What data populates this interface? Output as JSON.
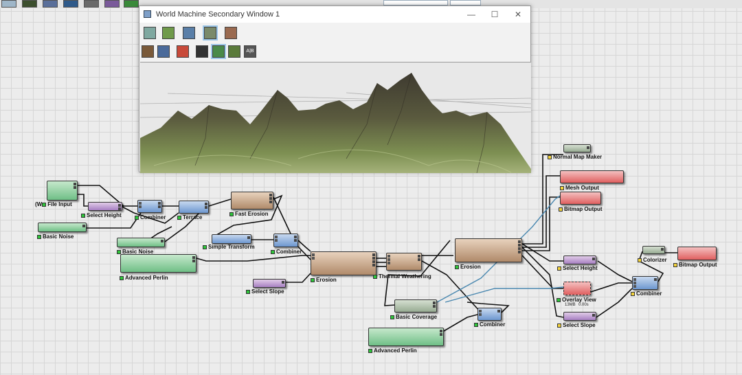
{
  "secondary_window": {
    "title": "World Machine Secondary Window 1",
    "controls": {
      "minimize": "—",
      "maximize": "☐",
      "close": "✕"
    },
    "ab_button": "A|B"
  },
  "nodes": {
    "file_input": "File Input",
    "file_input_prefix": "(W",
    "select_height_1": "Select Height",
    "combiner_1": "Combiner",
    "terrace": "Terrace",
    "fast_erosion": "Fast Erosion",
    "basic_noise_1": "Basic Noise",
    "basic_noise_2": "Basic Noise",
    "simple_transform": "Simple Transform",
    "combiner_2": "Combiner",
    "advanced_perlin_1": "Advanced Perlin",
    "erosion_1": "Erosion",
    "thermal_weathering": "Thermal Weathering",
    "select_slope_1": "Select Slope",
    "erosion_2": "Erosion",
    "basic_coverage": "Basic Coverage",
    "combiner_3": "Combiner",
    "advanced_perlin_2": "Advanced Perlin",
    "normal_map_maker": "Normal Map Maker",
    "mesh_output": "Mesh Output",
    "bitmap_output_1": "Bitmap Output",
    "select_height_2": "Select Height",
    "overlay_view": "Overlay View",
    "overlay_mem": "13MB",
    "overlay_time": "0.00s",
    "select_slope_2": "Select Slope",
    "colorizer": "Colorizer",
    "bitmap_output_2": "Bitmap Output",
    "combiner_4": "Combiner"
  },
  "colors": {
    "generator": "#6fbf86",
    "selector": "#a77fc2",
    "combiner": "#6d97cf",
    "natural": "#b08a6a",
    "output": "#e06060",
    "port_green": "#2ec43a",
    "port_yellow": "#f2d23a"
  }
}
